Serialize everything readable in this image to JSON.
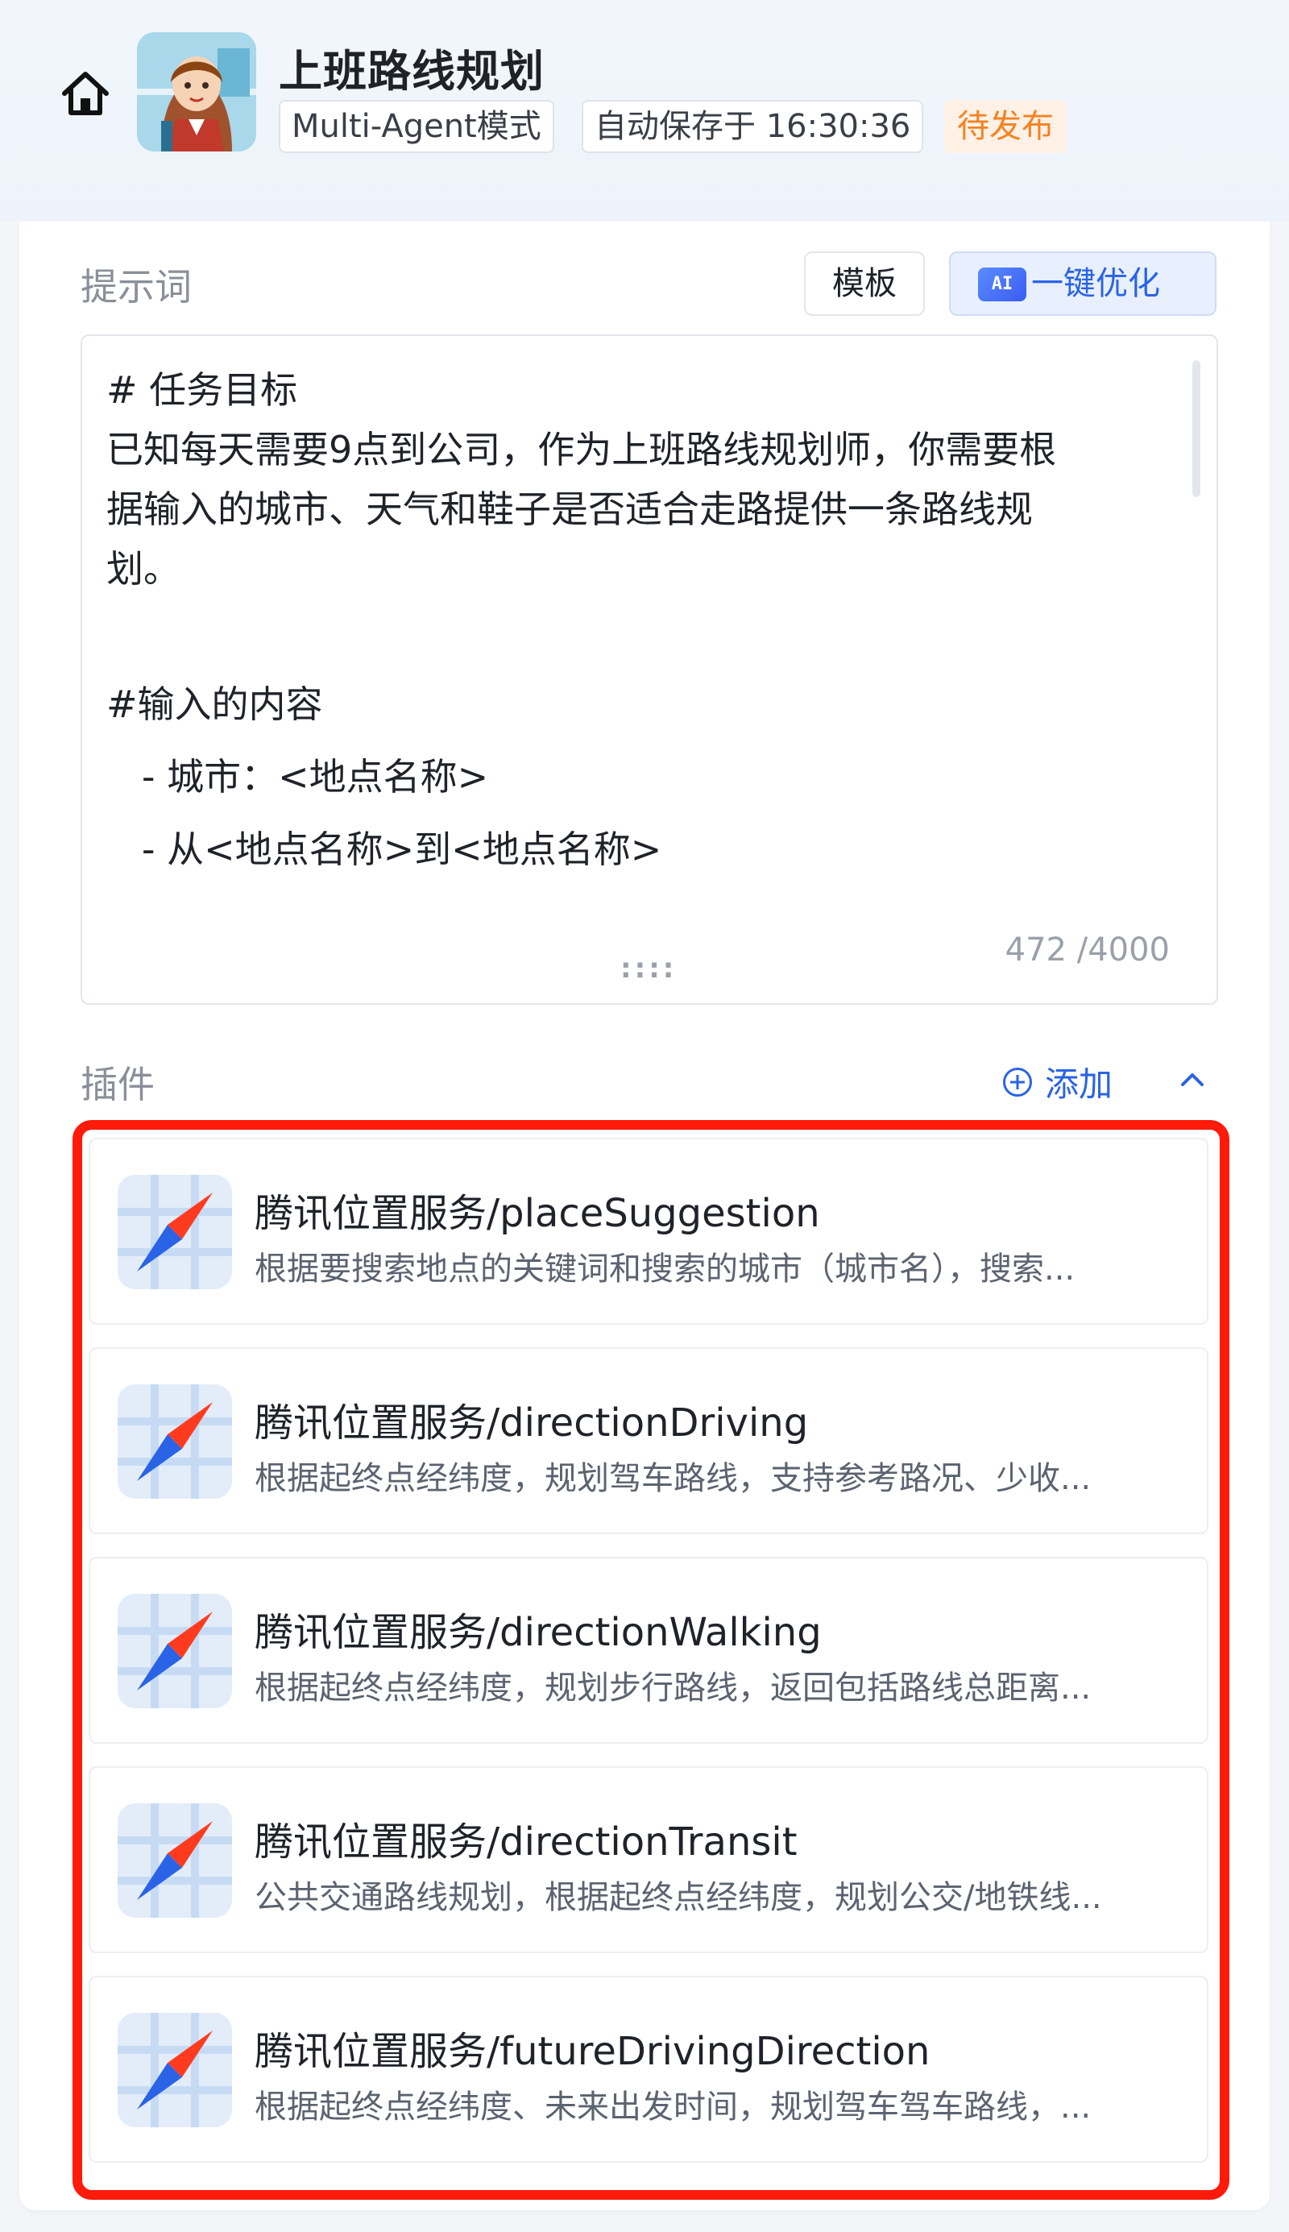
{
  "header": {
    "title": "上班路线规划",
    "mode_tag": "Multi-Agent模式",
    "save_tag": "自动保存于 16:30:36",
    "status_tag": "待发布"
  },
  "prompt": {
    "label": "提示词",
    "template_button": "模板",
    "ai_badge": "AI",
    "optimize_button": "一键优化",
    "lines": [
      "# 任务目标",
      "已知每天需要9点到公司，作为上班路线规划师，你需要根",
      "据输入的城市、天气和鞋子是否适合走路提供一条路线规",
      "划。",
      "",
      "#输入的内容",
      "   - 城市：<地点名称>",
      "   - 从<地点名称>到<地点名称>"
    ],
    "drag_handle": "::::",
    "char_count": "472 /4000"
  },
  "plugins": {
    "label": "插件",
    "add_button": "添加",
    "items": [
      {
        "name": "腾讯位置服务/placeSuggestion",
        "desc": "根据要搜索地点的关键词和搜索的城市（城市名），搜索..."
      },
      {
        "name": "腾讯位置服务/directionDriving",
        "desc": "根据起终点经纬度，规划驾车路线，支持参考路况、少收..."
      },
      {
        "name": "腾讯位置服务/directionWalking",
        "desc": "根据起终点经纬度，规划步行路线，返回包括路线总距离..."
      },
      {
        "name": "腾讯位置服务/directionTransit",
        "desc": "公共交通路线规划，根据起终点经纬度，规划公交/地铁线..."
      },
      {
        "name": "腾讯位置服务/futureDrivingDirection",
        "desc": "根据起终点经纬度、未来出发时间，规划驾车驾车路线，..."
      }
    ]
  },
  "colors": {
    "accent": "#2a63e6",
    "status": "#f5821f",
    "highlight_frame": "#ff1a0a"
  },
  "icons": {
    "home": "home-icon",
    "plugin": "compass-icon",
    "add": "plus-circle-icon",
    "collapse": "chevron-up-icon"
  }
}
